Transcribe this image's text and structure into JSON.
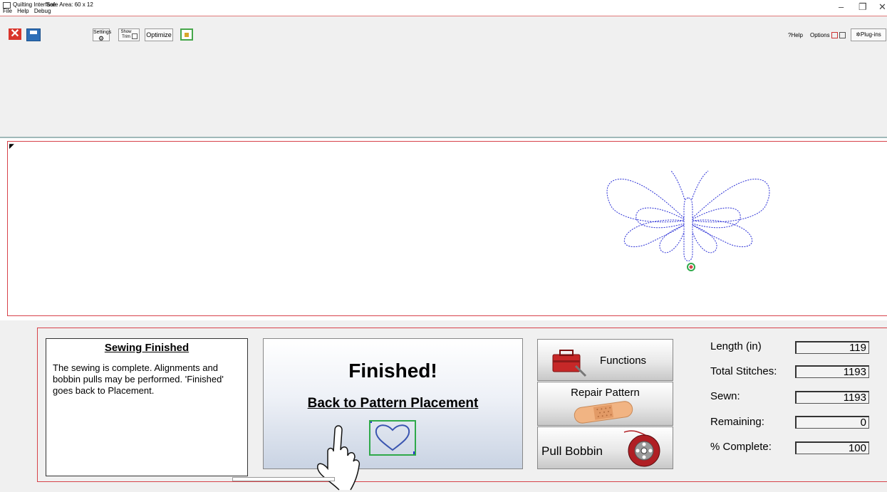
{
  "window": {
    "title": "Quilting Interface",
    "safe_area": "Safe Area: 60 x 12",
    "menu": [
      "File",
      "Help",
      "Debug"
    ],
    "controls": {
      "minimize": "–",
      "maximize": "❐",
      "close": "✕"
    }
  },
  "toolbar": {
    "settings_label": "Settings",
    "show_trim_label": "Show Trim",
    "optimize_label": "Optimize",
    "help_label": "?Help",
    "options_label": "Options",
    "plugins_label": "Plug-ins"
  },
  "status": {
    "title": "Sewing Finished",
    "body": "The sewing is complete. Alignments and bobbin pulls may be performed. 'Finished' goes back to Placement."
  },
  "finish": {
    "title": "Finished!",
    "back_label": "Back to Pattern Placement"
  },
  "actions": {
    "functions_label": "Functions",
    "repair_label": "Repair Pattern",
    "bobbin_label": "Pull Bobbin"
  },
  "stats": [
    {
      "label": "Length (in)",
      "value": "119"
    },
    {
      "label": "Total Stitches:",
      "value": "1193"
    },
    {
      "label": "Sewn:",
      "value": "1193"
    },
    {
      "label": "Remaining:",
      "value": "0"
    },
    {
      "label": "% Complete:",
      "value": "100"
    }
  ],
  "colors": {
    "accent_red": "#d7434a",
    "stitch_blue": "#2a2fd6",
    "heart_green": "#2fa94a",
    "close_red": "#d9352c",
    "save_blue": "#2e6fb7"
  },
  "icons": [
    "close-icon",
    "save-icon",
    "settings-icon",
    "export-icon",
    "help-icon",
    "checkbox-icon",
    "plugins-icon",
    "toolbox-icon",
    "bandage-icon",
    "spool-icon",
    "heart-icon",
    "hand-pointer-icon"
  ]
}
